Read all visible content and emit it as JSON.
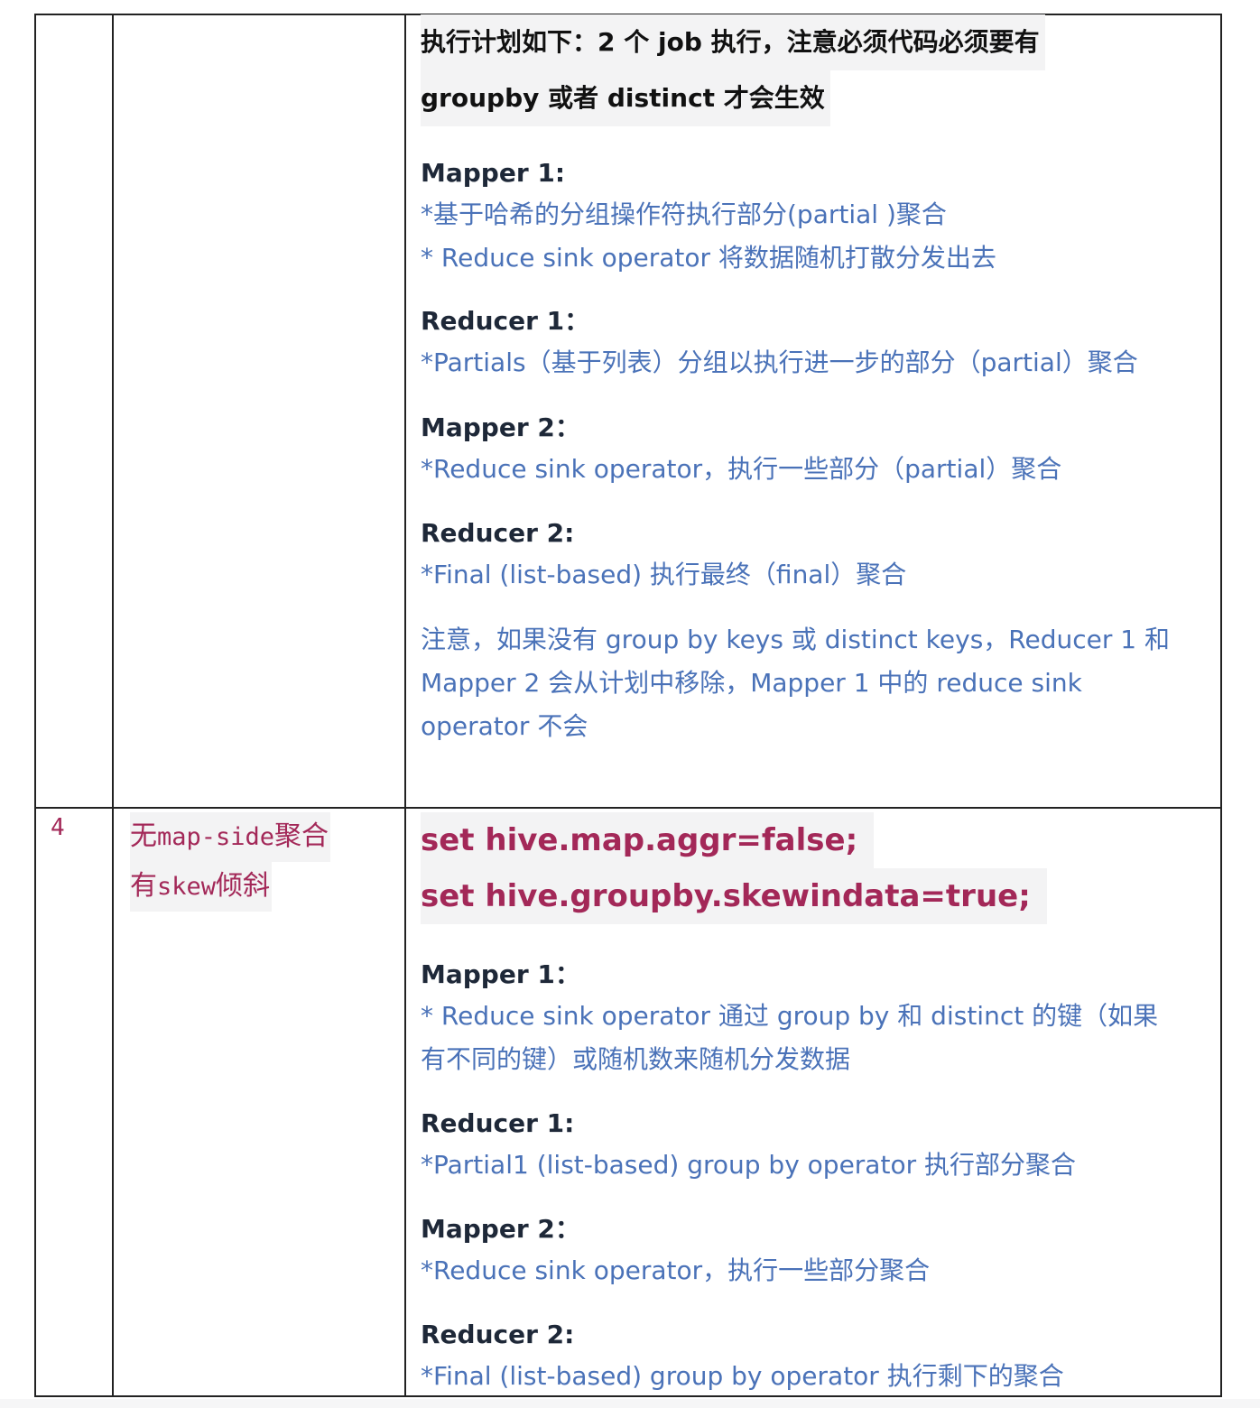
{
  "row_top": {
    "plan_line1": "执行计划如下：2 个 job 执行，注意必须代码必须要有",
    "plan_line2": "groupby 或者 distinct  才会生效",
    "mapper1_title": "Mapper 1:",
    "mapper1_line1": "*基于哈希的分组操作符执行部分(partial )聚合",
    "mapper1_line2": "* Reduce sink operator  将数据随机打散分发出去",
    "reducer1_title": "Reducer 1：",
    "reducer1_line1": "*Partials（基于列表）分组以执行进一步的部分（partial）聚合",
    "mapper2_title": "Mapper 2：",
    "mapper2_line1": "*Reduce sink operator，执行一些部分（partial）聚合",
    "reducer2_title": "Reducer 2:",
    "reducer2_line1": "*Final (list-based)  执行最终（final）聚合",
    "note_line1": "注意，如果没有 group by keys 或 distinct keys，Reducer 1 和",
    "note_line2": "Mapper 2 会从计划中移除，Mapper 1 中的 reduce sink",
    "note_line3": "operator 不会"
  },
  "row4": {
    "number": "4",
    "desc_line1_a": "无",
    "desc_line1_code": "map-side",
    "desc_line1_b": "聚合",
    "desc_line2_a": "有",
    "desc_line2_code": "skew",
    "desc_line2_b": "倾斜",
    "set1": "set hive.map.aggr=false;",
    "set2": "set hive.groupby.skewindata=true;",
    "mapper1_title": "Mapper 1：",
    "mapper1_line1": "* Reduce sink operator  通过  group by  和 distinct 的键（如果",
    "mapper1_line2": "有不同的键）或随机数来随机分发数据",
    "reducer1_title": "Reducer 1:",
    "reducer1_line1": "*Partial1 (list-based) group by operator  执行部分聚合",
    "mapper2_title": "Mapper 2：",
    "mapper2_line1": "*Reduce sink operator，执行一些部分聚合",
    "reducer2_title": "Reducer 2:",
    "reducer2_line1": "*Final (list-based) group by operator  执行剩下的聚合"
  },
  "colors": {
    "heading": "#1e2838",
    "body_blue": "#4a72b8",
    "code_red": "#a32858",
    "highlight_bg": "#f3f3f4"
  }
}
